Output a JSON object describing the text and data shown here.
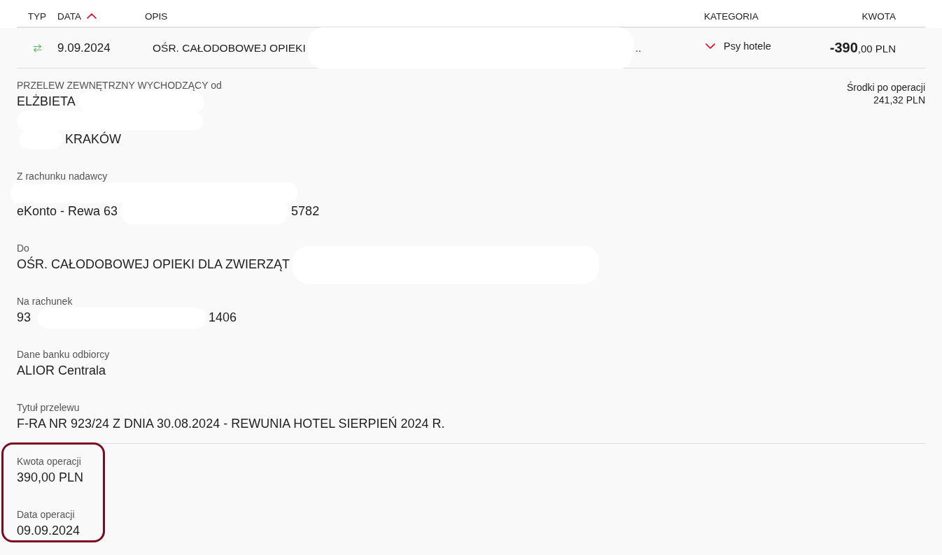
{
  "table": {
    "columns": [
      {
        "label": "TYP",
        "sorted": false
      },
      {
        "label": "DATA",
        "sorted": true
      },
      {
        "label": "OPIS",
        "sorted": false
      },
      {
        "label": "KATEGORIA",
        "sorted": false
      },
      {
        "label": "KWOTA",
        "sorted": false
      }
    ],
    "rows": [
      {
        "kind": "transfer",
        "date": "9.09.2024",
        "description": [
          {
            "kind": "text",
            "text": "OŚR. CAŁODOBOWEJ OPIEKI"
          },
          {
            "kind": "redacted"
          },
          {
            "kind": "text",
            "text": ".."
          }
        ],
        "category": "Psy hotele",
        "amount": "**-390**,00 PLN"
      }
    ]
  },
  "details": {
    "balance_after": {
      "label": "Środki po operacji",
      "value": "241,32 PLN"
    },
    "fields": [
      {
        "label": "PRZELEW ZEWNĘTRZNY WYCHODZĄCY od",
        "lines": [
          [
            {
              "kind": "text",
              "text": "ELŻBIETA"
            },
            {
              "kind": "redacted"
            }
          ],
          [
            {
              "kind": "redacted"
            }
          ],
          [
            {
              "kind": "redacted"
            },
            {
              "kind": "text",
              "text": "KRAKÓW"
            }
          ]
        ]
      },
      {
        "label": "Z rachunku nadawcy",
        "lines": [
          [
            {
              "kind": "redacted"
            }
          ],
          [
            {
              "kind": "text",
              "text": "eKonto - Rewa 63"
            },
            {
              "kind": "redacted"
            },
            {
              "kind": "text",
              "text": "5782"
            }
          ]
        ]
      },
      {
        "label": "Do",
        "lines": [
          [
            {
              "kind": "text",
              "text": "OŚR. CAŁODOBOWEJ OPIEKI DLA ZWIERZĄT"
            },
            {
              "kind": "redacted"
            }
          ]
        ]
      },
      {
        "label": "Na rachunek",
        "lines": [
          [
            {
              "kind": "text",
              "text": "93"
            },
            {
              "kind": "redacted"
            },
            {
              "kind": "text",
              "text": "1406"
            }
          ]
        ]
      },
      {
        "label": "Dane banku odbiorcy",
        "lines": [
          [
            {
              "kind": "text",
              "text": "ALIOR Centrala"
            }
          ]
        ]
      },
      {
        "label": "Tytuł przelewu",
        "lines": [
          [
            {
              "kind": "text",
              "text": "F-RA NR 923/24 Z DNIA 30.08.2024 - REWUNIA HOTEL SIERPIEŃ 2024 R."
            }
          ]
        ]
      }
    ],
    "summary": {
      "highlighted": true,
      "fields": [
        {
          "label": "Kwota operacji",
          "lines": [
            [
              {
                "kind": "text",
                "text": "390,00 PLN"
              }
            ]
          ]
        },
        {
          "label": "Data operacji",
          "lines": [
            [
              {
                "kind": "text",
                "text": "09.09.2024"
              }
            ]
          ]
        }
      ]
    }
  }
}
